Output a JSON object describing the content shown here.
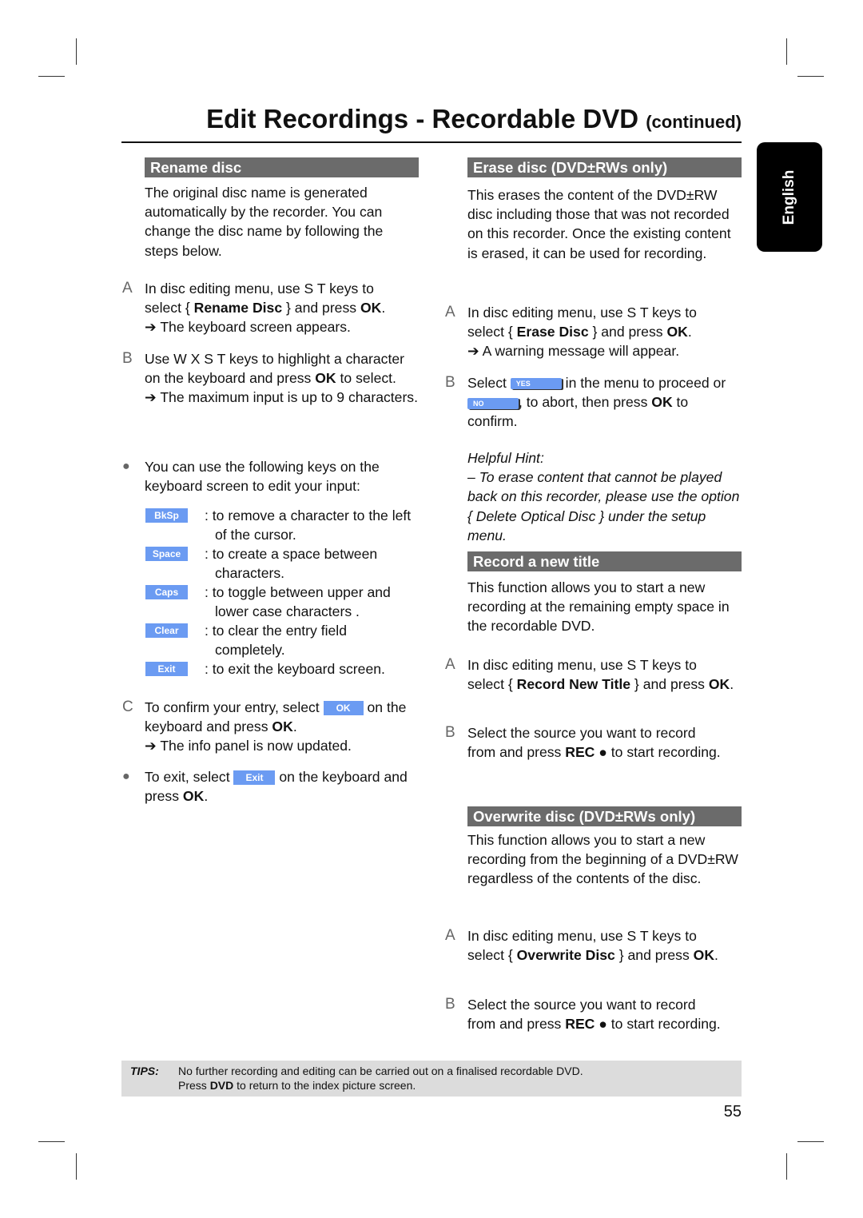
{
  "header": {
    "title": "Edit Recordings - Recordable DVD",
    "continued": "(continued)",
    "language_tab": "English"
  },
  "rename": {
    "heading": "Rename disc",
    "intro": "The original disc name is generated automatically by the recorder. You can change the disc name by following the steps below.",
    "step_a": {
      "label": "A",
      "pre": "In disc editing menu, use  S T  keys to select { ",
      "bold": "Rename Disc",
      "mid": " } and press ",
      "ok": "OK",
      "post": ".",
      "result": "The keyboard screen appears."
    },
    "step_b": {
      "label": "B",
      "pre": "Use  W X S T  keys to highlight a character on the keyboard and press ",
      "ok": "OK",
      "post": " to select.",
      "result": "The maximum input is up to 9 characters."
    },
    "bullet1": "You can use the following keys on the keyboard screen to edit your input:",
    "keys": [
      {
        "key": "BkSp",
        "text": ": to remove a character to the left of the cursor."
      },
      {
        "key": "Space",
        "text": ": to create a space between characters."
      },
      {
        "key": "Caps",
        "text": ": to toggle between upper and lower case characters ."
      },
      {
        "key": "Clear",
        "text": ": to clear the entry field completely."
      },
      {
        "key": "Exit",
        "text": ": to exit the keyboard screen."
      }
    ],
    "step_c": {
      "label": "C",
      "pre": "To confirm your entry, select ",
      "key": "OK",
      "mid": " on the keyboard and press ",
      "ok": "OK",
      "post": ".",
      "result": "The info panel is now updated."
    },
    "bullet2": {
      "pre": "To exit, select ",
      "key": "Exit",
      "mid": " on the keyboard and press ",
      "ok": "OK",
      "post": "."
    }
  },
  "erase": {
    "heading": "Erase disc (DVD±RWs only)",
    "intro": "This erases the content of the DVD±RW disc including those that was not recorded on this recorder. Once the existing content is erased, it can be used for recording.",
    "step_a": {
      "label": "A",
      "pre": "In disc editing menu, use  S T  keys to select { ",
      "bold": "Erase Disc",
      "mid": " } and press ",
      "ok": "OK",
      "post": ".",
      "result": "A warning message will appear."
    },
    "step_b": {
      "label": "B",
      "pre": "Select ",
      "yes": "YES",
      "mid": " in the menu to proceed or ",
      "no": "NO",
      "mid2": ", to abort, then press ",
      "ok": "OK",
      "post": " to confirm."
    },
    "hint_title": "Helpful Hint:",
    "hint": "–  To erase content that cannot be played back on this recorder, please use the option { Delete Optical Disc } under the setup menu."
  },
  "record": {
    "heading": "Record a new title",
    "intro": "This function allows you to start a new recording at the remaining empty space in the recordable DVD.",
    "step_a": {
      "label": "A",
      "pre": "In disc editing menu, use  S T  keys to select { ",
      "bold": "Record New Title",
      "mid": " } and press ",
      "ok": "OK",
      "post": "."
    },
    "step_b": {
      "label": "B",
      "pre": "Select the source you want to record from and press ",
      "rec": "REC ●",
      "post": "  to start recording."
    }
  },
  "overwrite": {
    "heading": "Overwrite disc (DVD±RWs only)",
    "intro": "This function allows you to start a new recording from the beginning of a DVD±RW regardless of the contents of the disc.",
    "step_a": {
      "label": "A",
      "pre": "In disc editing menu, use  S T  keys to select { ",
      "bold": "Overwrite Disc",
      "mid": " } and press ",
      "ok": "OK",
      "post": "."
    },
    "step_b": {
      "label": "B",
      "pre": "Select the source you want to record from and press ",
      "rec": "REC ●",
      "post": "  to start recording."
    }
  },
  "tips": {
    "label": "TIPS:",
    "line1": "No further recording and editing can be carried out on a finalised recordable DVD.",
    "line2_pre": "Press ",
    "line2_bold": "DVD",
    "line2_post": " to return to the index picture screen."
  },
  "page_number": "55",
  "colors": {
    "key_button": "#6b9bf2",
    "section_bar": "#6b6b6b",
    "tips_bg": "#dcdcdc"
  }
}
